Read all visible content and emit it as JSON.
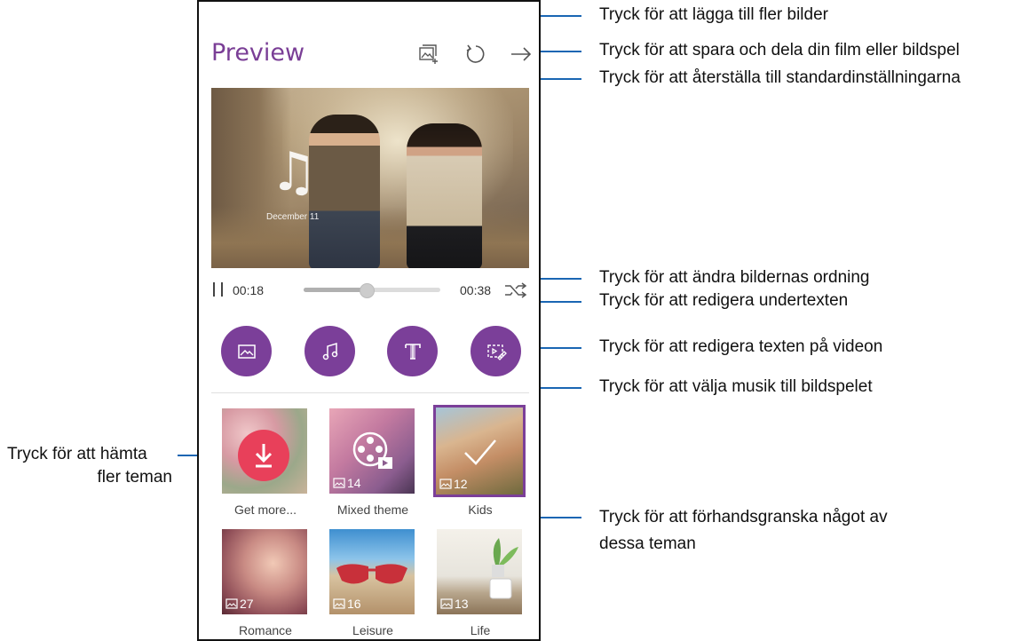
{
  "screen": {
    "title": "Preview",
    "hero": {
      "date_label": "December 11",
      "music_note": "♫"
    },
    "player": {
      "elapsed": "00:18",
      "total": "00:38",
      "progress": 0.46
    },
    "themes": [
      {
        "label": "Get more...",
        "count": ""
      },
      {
        "label": "Mixed theme",
        "count": "14"
      },
      {
        "label": "Kids",
        "count": "12",
        "selected": true
      },
      {
        "label": "Romance",
        "count": "27"
      },
      {
        "label": "Leisure",
        "count": "16"
      },
      {
        "label": "Life",
        "count": "13"
      }
    ],
    "colors": {
      "accent": "#7b3f99",
      "get_more": "#e8405a"
    }
  },
  "callouts": {
    "add_images": "Tryck för att lägga till fler bilder",
    "save_share": "Tryck för att spara och dela din film eller bildspel",
    "reset": "Tryck för att återställa till standardinställningarna",
    "reorder": "Tryck för att ändra bildernas ordning",
    "subtitle": "Tryck för att redigera undertexten",
    "video_text": "Tryck för att redigera texten på videon",
    "music": "Tryck för att välja musik till bildspelet",
    "download_line1": "Tryck för att hämta",
    "download_line2": "fler teman",
    "preview_line1": "Tryck för att förhandsgranska något av",
    "preview_line2": "dessa teman"
  }
}
